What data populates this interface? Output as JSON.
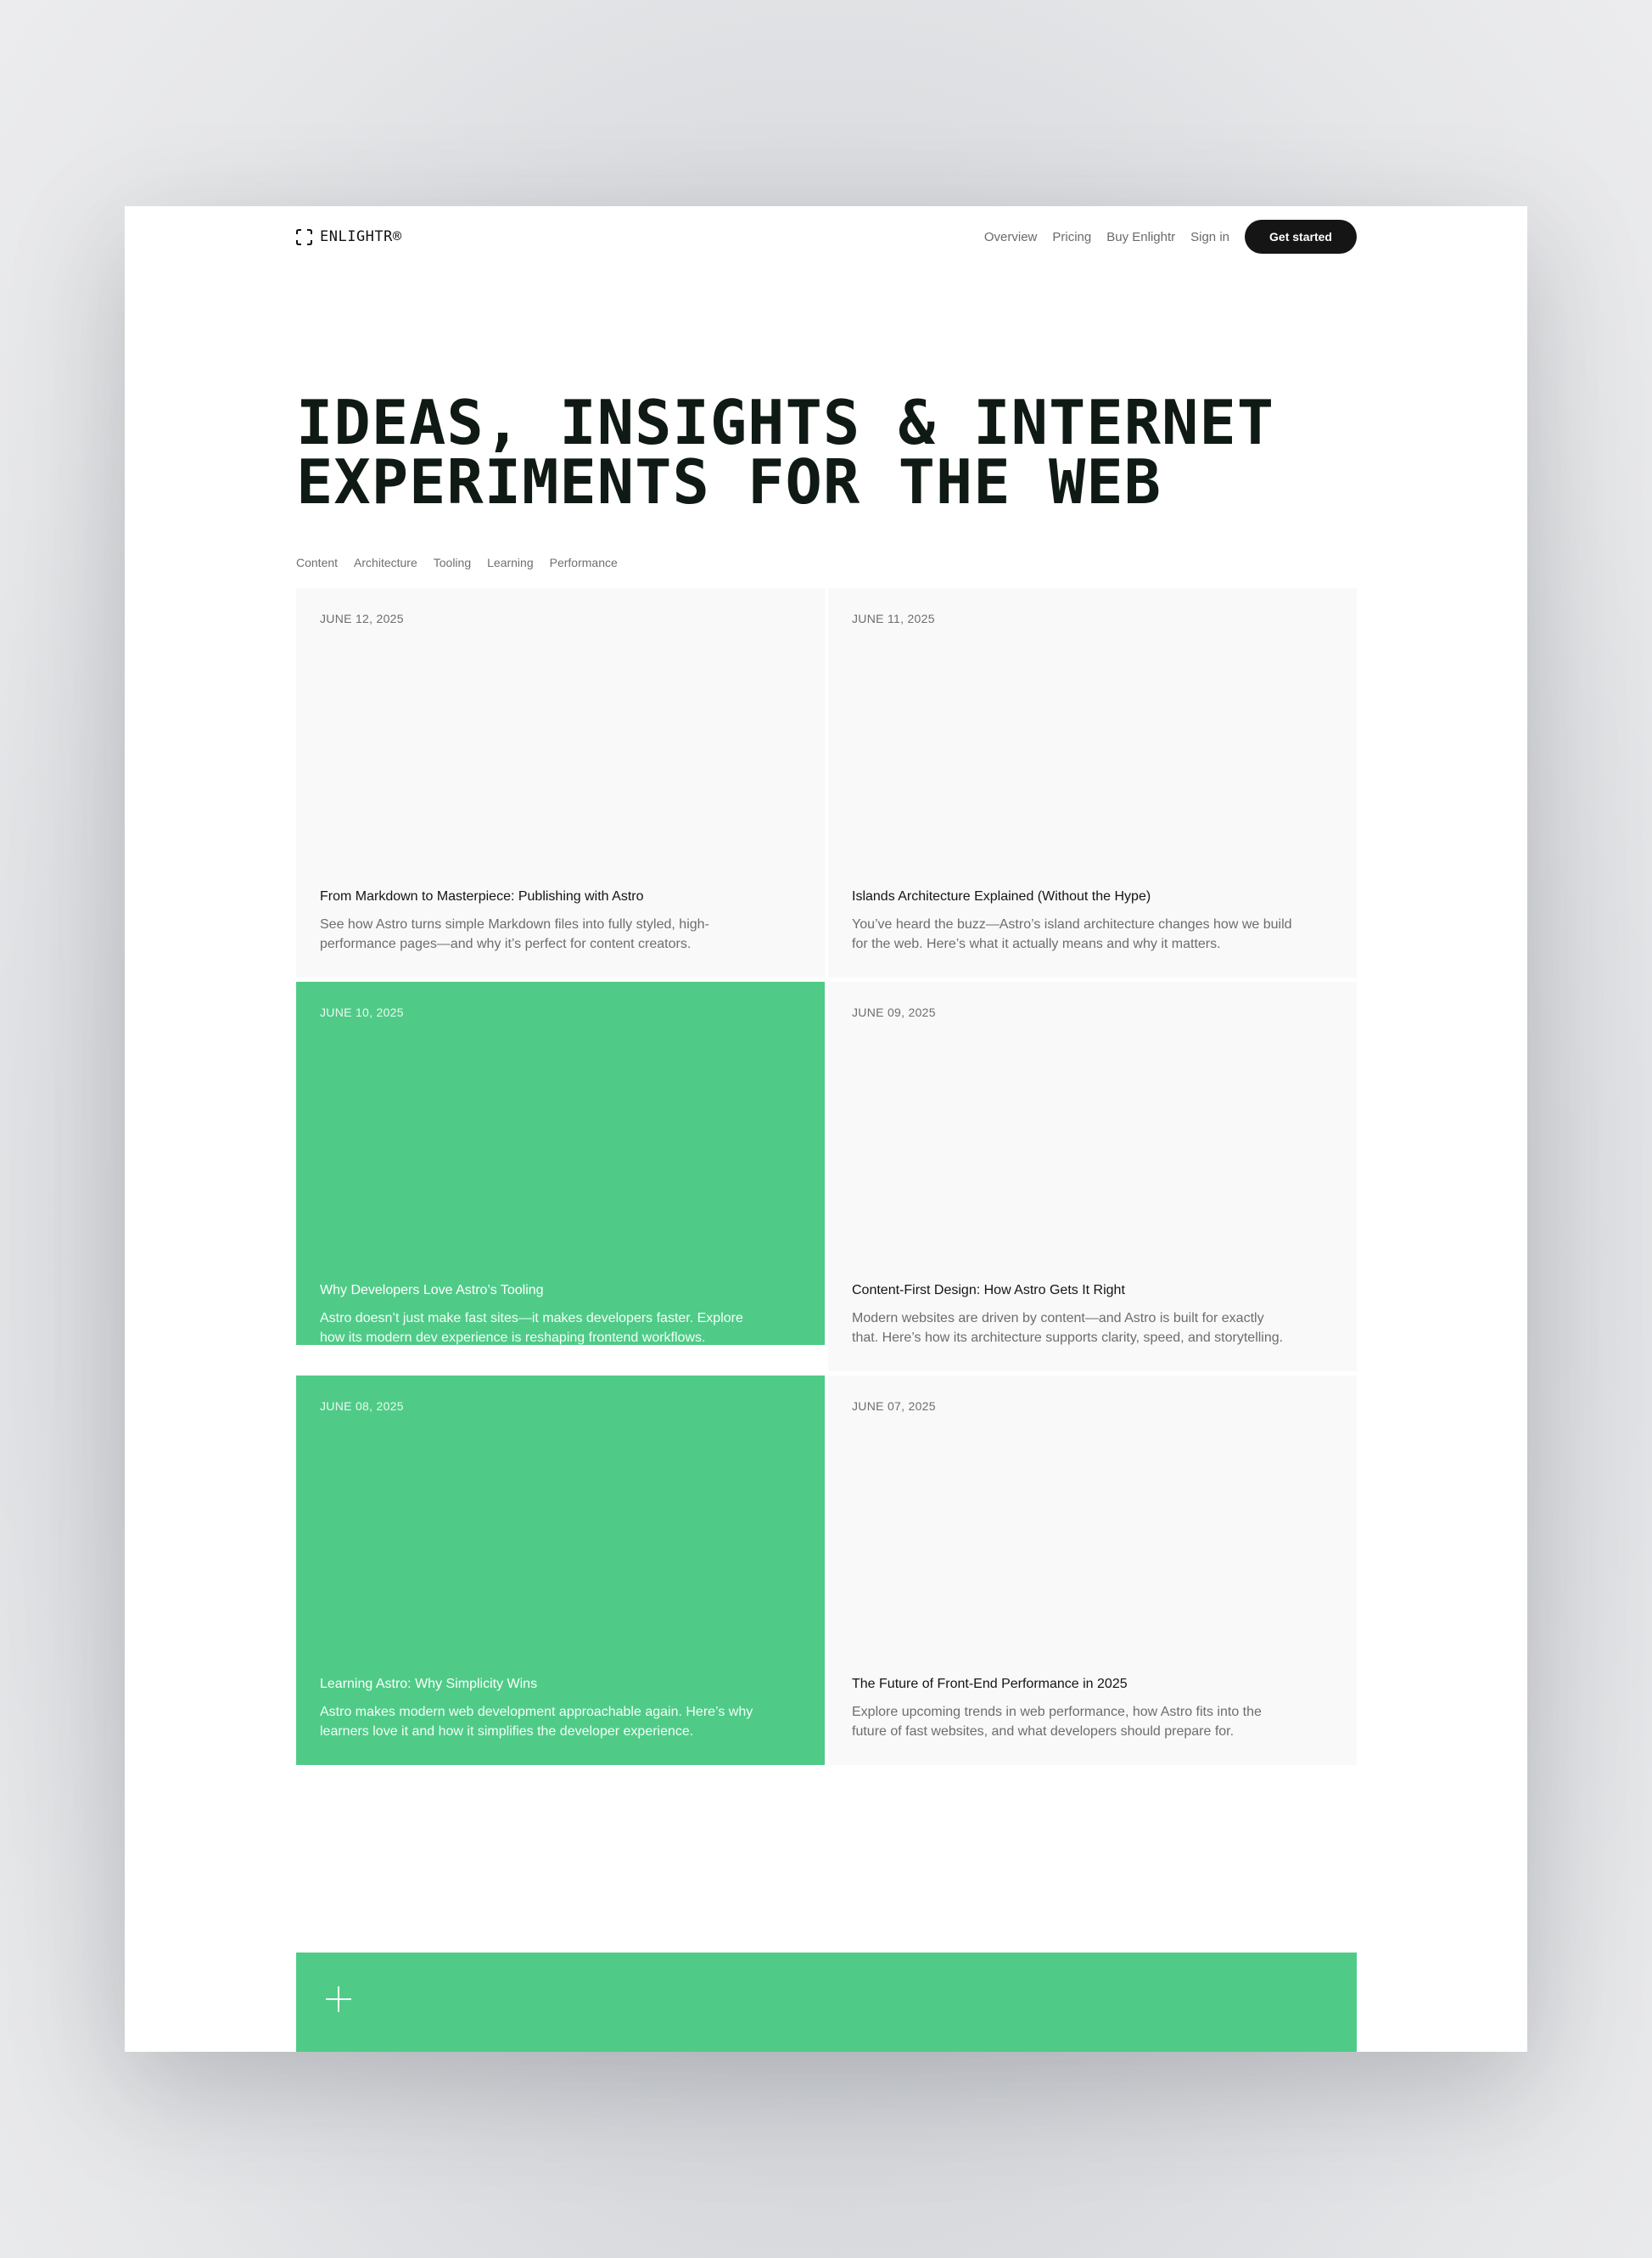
{
  "brand": {
    "name": "ENLIGHTR®",
    "icon": "bracket-frame-icon"
  },
  "nav": {
    "links": [
      "Overview",
      "Pricing",
      "Buy Enlightr",
      "Sign in"
    ],
    "cta": "Get started"
  },
  "hero": {
    "line1": "IDEAS, INSIGHTS & INTERNET",
    "line2": "EXPERIMENTS FOR THE WEB"
  },
  "categories": [
    "Content",
    "Architecture",
    "Tooling",
    "Learning",
    "Performance"
  ],
  "posts": [
    {
      "date": "JUNE 12, 2025",
      "title": "From Markdown to Masterpiece: Publishing with Astro",
      "description": "See how Astro turns simple Markdown files into fully styled, high-performance pages—and why it’s perfect for content creators."
    },
    {
      "date": "JUNE 11, 2025",
      "title": "Islands Architecture Explained (Without the Hype)",
      "description": "You’ve heard the buzz—Astro’s island architecture changes how we build for the web. Here’s what it actually means and why it matters."
    },
    {
      "date": "JUNE 10, 2025",
      "title": "Why Developers Love Astro’s Tooling",
      "description": "Astro doesn’t just make fast sites—it makes developers faster. Explore how its modern dev experience is reshaping frontend workflows."
    },
    {
      "date": "JUNE 09, 2025",
      "title": "Content-First Design: How Astro Gets It Right",
      "description": "Modern websites are driven by content—and Astro is built for exactly that. Here’s how its architecture supports clarity, speed, and storytelling."
    },
    {
      "date": "JUNE 08, 2025",
      "title": "Learning Astro: Why Simplicity Wins",
      "description": "Astro makes modern web development approachable again. Here’s why learners love it and how it simplifies the developer experience."
    },
    {
      "date": "JUNE 07, 2025",
      "title": "The Future of Front-End Performance in 2025",
      "description": "Explore upcoming trends in web performance, how Astro fits into the future of fast websites, and what developers should prepare for."
    }
  ],
  "banner": {
    "icon": "plus-icon"
  },
  "colors": {
    "accent": "#4fcb87",
    "dark": "#151515",
    "card": "#f9f9f9"
  }
}
